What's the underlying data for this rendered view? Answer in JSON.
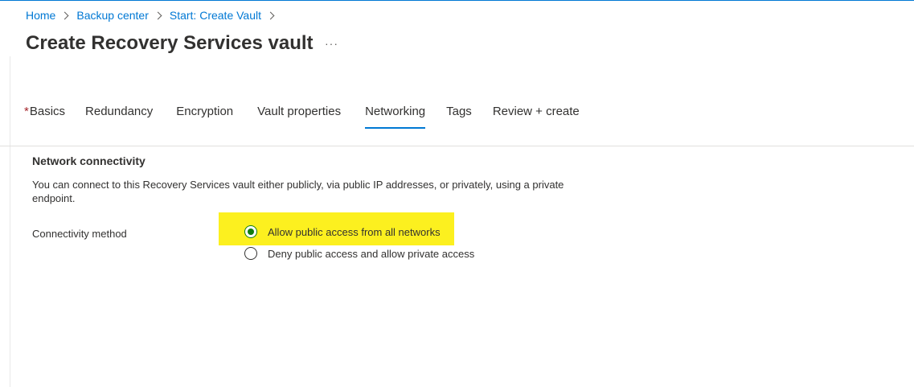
{
  "breadcrumb": {
    "items": [
      "Home",
      "Backup center",
      "Start: Create Vault"
    ]
  },
  "page": {
    "title": "Create Recovery Services vault",
    "more_label": "···"
  },
  "tabs": [
    {
      "label": "Basics",
      "required": true,
      "active": false
    },
    {
      "label": "Redundancy",
      "required": false,
      "active": false
    },
    {
      "label": "Encryption",
      "required": false,
      "active": false
    },
    {
      "label": "Vault properties",
      "required": false,
      "active": false
    },
    {
      "label": "Networking",
      "required": false,
      "active": true
    },
    {
      "label": "Tags",
      "required": false,
      "active": false
    },
    {
      "label": "Review + create",
      "required": false,
      "active": false
    }
  ],
  "required_marker": "*",
  "network": {
    "section_title": "Network connectivity",
    "description": "You can connect to this Recovery Services vault either publicly, via public IP addresses, or privately, using a private endpoint.",
    "connectivity_label": "Connectivity method",
    "options": [
      {
        "label": "Allow public access from all networks",
        "selected": true
      },
      {
        "label": "Deny public access and allow private access",
        "selected": false
      }
    ]
  },
  "colors": {
    "accent": "#0078d4",
    "highlight": "#fcf01f",
    "radio_selected": "#107c10",
    "required": "#a4262c"
  }
}
